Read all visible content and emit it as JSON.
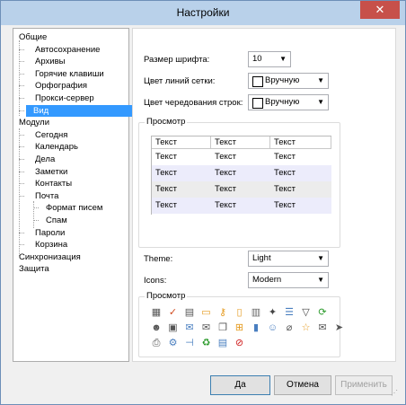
{
  "window": {
    "title": "Настройки",
    "close": "✕"
  },
  "tree": {
    "items": [
      {
        "label": "Общие",
        "level": 0,
        "selected": false
      },
      {
        "label": "Автосохранение",
        "level": 1,
        "selected": false
      },
      {
        "label": "Архивы",
        "level": 1,
        "selected": false
      },
      {
        "label": "Горячие клавиши",
        "level": 1,
        "selected": false
      },
      {
        "label": "Орфография",
        "level": 1,
        "selected": false
      },
      {
        "label": "Прокси-сервер",
        "level": 1,
        "selected": false
      },
      {
        "label": "Вид",
        "level": 1,
        "selected": true
      },
      {
        "label": "Модули",
        "level": 0,
        "selected": false
      },
      {
        "label": "Сегодня",
        "level": 1,
        "selected": false
      },
      {
        "label": "Календарь",
        "level": 1,
        "selected": false
      },
      {
        "label": "Дела",
        "level": 1,
        "selected": false
      },
      {
        "label": "Заметки",
        "level": 1,
        "selected": false
      },
      {
        "label": "Контакты",
        "level": 1,
        "selected": false
      },
      {
        "label": "Почта",
        "level": 1,
        "selected": false
      },
      {
        "label": "Формат писем",
        "level": 2,
        "selected": false
      },
      {
        "label": "Спам",
        "level": 2,
        "selected": false
      },
      {
        "label": "Пароли",
        "level": 1,
        "selected": false
      },
      {
        "label": "Корзина",
        "level": 1,
        "selected": false
      },
      {
        "label": "Синхронизация",
        "level": 0,
        "selected": false
      },
      {
        "label": "Защита",
        "level": 0,
        "selected": false
      }
    ]
  },
  "view": {
    "font_size_label": "Размер шрифта:",
    "font_size_value": "10",
    "grid_color_label": "Цвет линий сетки:",
    "grid_color_value": "Вручную",
    "row_color_label": "Цвет чередования строк:",
    "row_color_value": "Вручную",
    "preview1_label": "Просмотр",
    "grid_headers": [
      "Текст",
      "Текст",
      "Текст"
    ],
    "grid_rows": [
      [
        "Текст",
        "Текст",
        "Текст"
      ],
      [
        "Текст",
        "Текст",
        "Текст"
      ],
      [
        "Текст",
        "Текст",
        "Текст"
      ],
      [
        "Текст",
        "Текст",
        "Текст"
      ]
    ],
    "row_colors": [
      "#ffffff",
      "#ececfb",
      "#ececec",
      "#ececfb"
    ],
    "theme_label": "Theme:",
    "theme_value": "Light",
    "icons_label": "Icons:",
    "icons_value": "Modern",
    "preview2_label": "Просмотр",
    "icons": [
      [
        "calendar-icon",
        "task-check-icon",
        "contact-card-icon",
        "note-icon",
        "key-icon",
        "page-icon",
        "trash-icon",
        "pin-icon",
        "list-icon",
        "filter-icon",
        "sync-icon"
      ],
      [
        "people-icon",
        "contacts-book-icon",
        "mail-icon",
        "mail-open-icon",
        "copy-icon",
        "tree-icon",
        "book-icon",
        "person-icon",
        "attachment-icon",
        "star-icon",
        "envelope-icon",
        "send-icon"
      ],
      [
        "printer-icon",
        "gear-icon",
        "pin-left-icon",
        "recycle-icon",
        "presentation-icon",
        "block-icon"
      ]
    ]
  },
  "buttons": {
    "ok": "Да",
    "cancel": "Отмена",
    "apply": "Применить"
  }
}
